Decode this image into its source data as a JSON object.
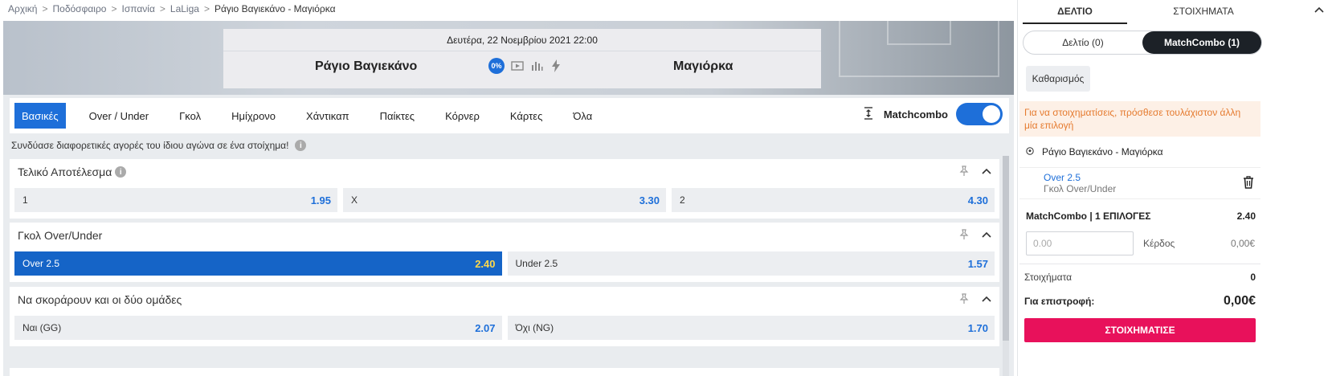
{
  "breadcrumb": [
    {
      "label": "Αρχική"
    },
    {
      "label": "Ποδόσφαιρο"
    },
    {
      "label": "Ισπανία"
    },
    {
      "label": "LaLiga"
    },
    {
      "label": "Ράγιο Βαγιεκάνο - Μαγιόρκα"
    }
  ],
  "match": {
    "date": "Δευτέρα, 22 Νοεμβρίου 2021 22:00",
    "home": "Ράγιο Βαγιεκάνο",
    "away": "Μαγιόρκα",
    "percent": "0%"
  },
  "tabs": [
    "Βασικές",
    "Over / Under",
    "Γκολ",
    "Ημίχρονο",
    "Χάντικαπ",
    "Παίκτες",
    "Κόρνερ",
    "Κάρτες",
    "Όλα"
  ],
  "matchcombo": {
    "label": "Matchcombo",
    "enabled": true
  },
  "hint": "Συνδύασε διαφορετικές αγορές του ίδιου αγώνα σε ένα στοίχημα!",
  "markets": [
    {
      "title": "Τελικό Αποτέλεσμα",
      "has_info": true,
      "odds": [
        {
          "label": "1",
          "price": "1.95",
          "selected": false
        },
        {
          "label": "X",
          "price": "3.30",
          "selected": false
        },
        {
          "label": "2",
          "price": "4.30",
          "selected": false
        }
      ]
    },
    {
      "title": "Γκολ Over/Under",
      "has_info": false,
      "odds": [
        {
          "label": "Over 2.5",
          "price": "2.40",
          "selected": true
        },
        {
          "label": "Under 2.5",
          "price": "1.57",
          "selected": false
        }
      ]
    },
    {
      "title": "Να σκοράρουν και οι δύο ομάδες",
      "has_info": false,
      "odds": [
        {
          "label": "Ναι (GG)",
          "price": "2.07",
          "selected": false
        },
        {
          "label": "Όχι (NG)",
          "price": "1.70",
          "selected": false
        }
      ]
    }
  ],
  "betslip": {
    "tabs": [
      "ΔΕΛΤΙΟ",
      "ΣΤΟΙΧΗΜΑΤΑ"
    ],
    "switch": [
      "Δελτίο (0)",
      "MatchCombo (1)"
    ],
    "clear": "Καθαρισμός",
    "warning": "Για να στοιχηματίσεις, πρόσθεσε τουλάχιστον άλλη μία επιλογή",
    "match": "Ράγιο Βαγιεκάνο - Μαγιόρκα",
    "selection_name": "Over 2.5",
    "selection_market": "Γκολ Over/Under",
    "combo_label": "MatchCombo | 1 ΕΠΙΛΟΓΕΣ",
    "combo_odds": "2.40",
    "stake_placeholder": "0.00",
    "profit_label": "Κέρδος",
    "profit_value": "0,00€",
    "bets_label": "Στοιχήματα",
    "bets_value": "0",
    "return_label": "Για επιστροφή:",
    "return_value": "0,00€",
    "bet_button": "ΣΤΟΙΧΗΜΑΤΙΣΕ"
  },
  "colors": {
    "accent": "#1e6fd9",
    "selected": "#1564c7",
    "bet_button": "#e8115b",
    "warning_text": "#e57a2e"
  }
}
